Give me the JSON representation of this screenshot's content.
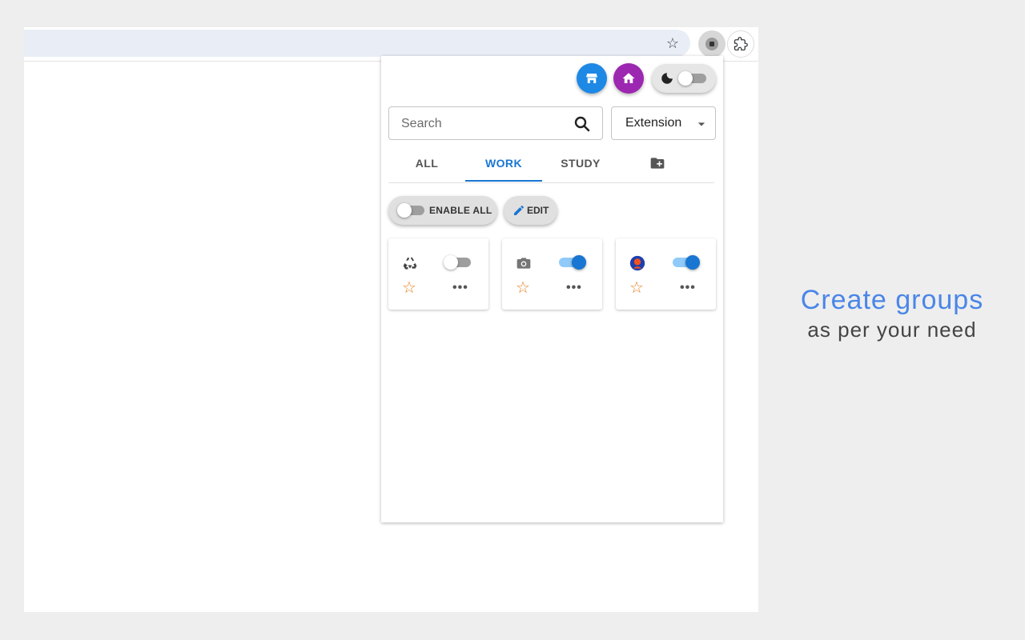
{
  "popup": {
    "search": {
      "placeholder": "Search",
      "value": ""
    },
    "filter_select": {
      "value": "Extension"
    },
    "tabs": [
      {
        "label": "ALL",
        "active": false
      },
      {
        "label": "WORK",
        "active": true
      },
      {
        "label": "STUDY",
        "active": false
      }
    ],
    "theme_toggle": {
      "on": false
    },
    "enable_all": {
      "label": "ENABLE ALL",
      "on": false
    },
    "edit": {
      "label": "EDIT"
    },
    "extensions": [
      {
        "icon": "recycle-icon",
        "enabled": false,
        "favorite": false
      },
      {
        "icon": "camera-icon",
        "enabled": true,
        "favorite": false
      },
      {
        "icon": "avatar-icon",
        "enabled": true,
        "favorite": false
      }
    ]
  },
  "caption": {
    "title": "Create groups",
    "subtitle": "as per your need"
  },
  "colors": {
    "accent": "#1976d2",
    "store_button": "#1e88e5",
    "home_button": "#9c27b0",
    "caption_title": "#4a86e8",
    "favorite_star": "#e67e22"
  },
  "icons": {
    "card_more": "•••",
    "card_star": "☆"
  }
}
